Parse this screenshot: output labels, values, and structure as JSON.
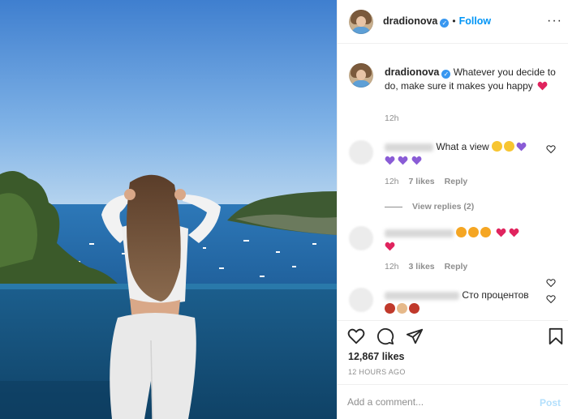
{
  "post": {
    "author": "dradionova",
    "follow_label": "Follow",
    "separator": "•",
    "more_label": "···"
  },
  "caption": {
    "username": "dradionova",
    "text": "Whatever you decide to do, make sure it makes you happy",
    "time": "12h"
  },
  "comments": [
    {
      "text": "What a view",
      "time": "12h",
      "likes": "7 likes",
      "reply_label": "Reply",
      "view_replies": "View replies (2)"
    },
    {
      "text": "",
      "time": "12h",
      "likes": "3 likes",
      "reply_label": "Reply"
    },
    {
      "text": "Сто процентов",
      "time": "",
      "likes": "",
      "reply_label": ""
    }
  ],
  "actions": {
    "like_icon": "heart-icon",
    "comment_icon": "speech-bubble-icon",
    "share_icon": "paper-plane-icon",
    "save_icon": "bookmark-icon"
  },
  "likes_count": "12,867 likes",
  "posted_ago": "12 HOURS AGO",
  "add_comment": {
    "placeholder": "Add a comment...",
    "post_label": "Post"
  },
  "colors": {
    "accent": "#0095f6",
    "verified": "#3897f0",
    "muted": "#8e8e8e",
    "heart_red": "#ed4956",
    "post_disabled": "#b2dffc"
  }
}
